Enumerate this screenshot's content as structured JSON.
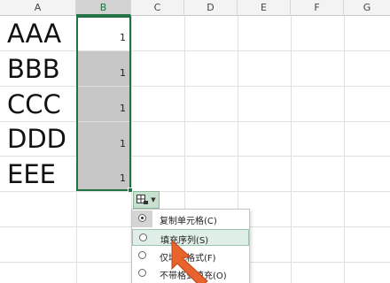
{
  "columns": [
    "A",
    "B",
    "C",
    "D",
    "E",
    "F",
    "G"
  ],
  "rows": [
    {
      "a": "AAA",
      "b": "1"
    },
    {
      "a": "BBB",
      "b": "1"
    },
    {
      "a": "CCC",
      "b": "1"
    },
    {
      "a": "DDD",
      "b": "1"
    },
    {
      "a": "EEE",
      "b": "1"
    }
  ],
  "autofill_menu": {
    "items": [
      {
        "label": "复制单元格(C)"
      },
      {
        "label": "填充序列(S)"
      },
      {
        "label": "仅填充格式(F)"
      },
      {
        "label": "不带格式填充(O)"
      }
    ],
    "selected_option": "复制单元格(C)",
    "hovered_option": "填充序列(S)"
  },
  "colors": {
    "selection_accent": "#217346",
    "shaded_cell": "#c6c6c6",
    "pointer_arrow": "#e8642c",
    "menu_hover": "#dfeee6"
  },
  "icons": {
    "autofill_options": "auto-fill-options-icon",
    "pointer": "arrow-pointer-icon"
  }
}
